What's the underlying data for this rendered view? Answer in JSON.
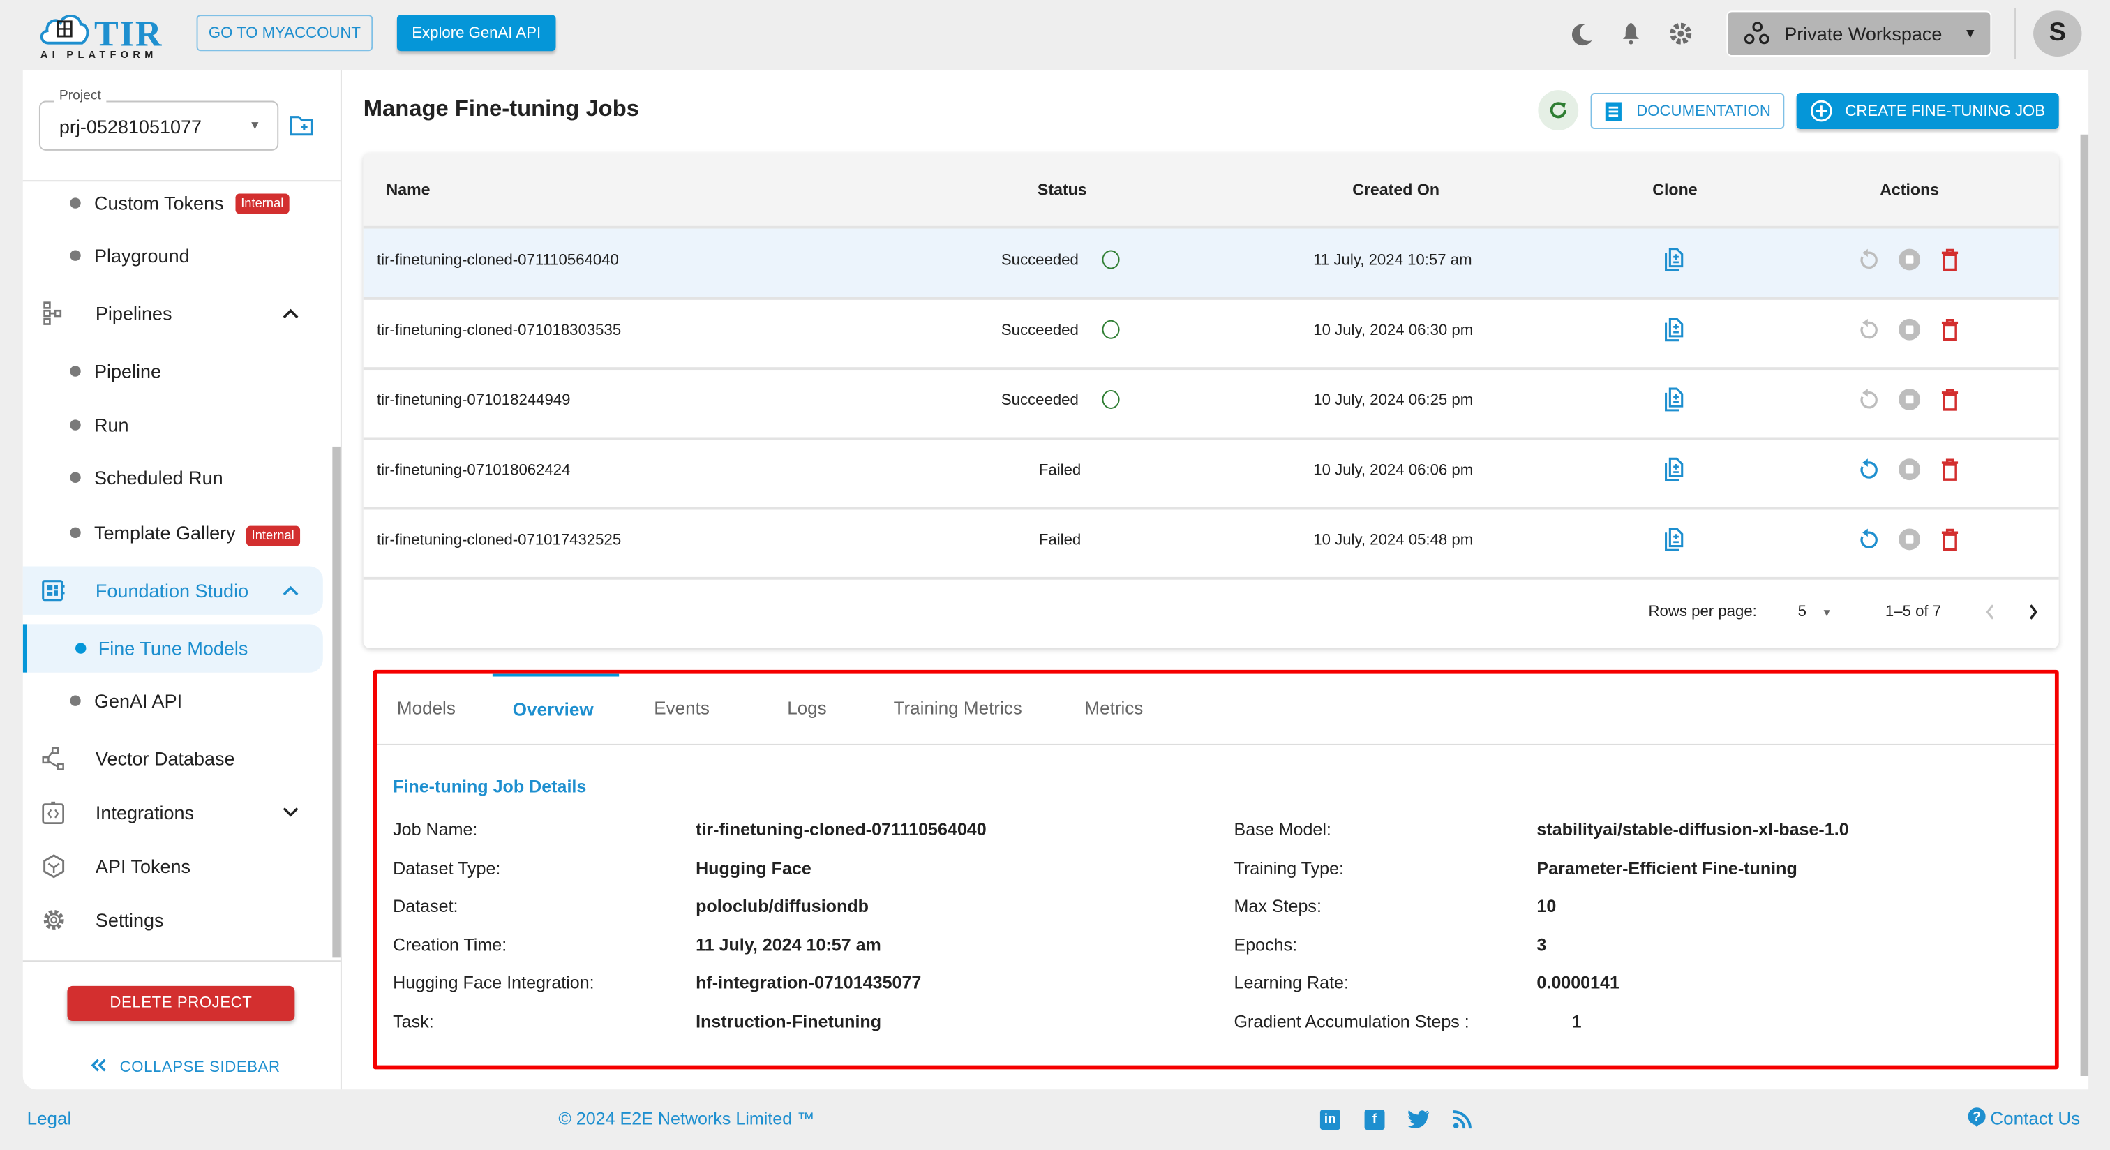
{
  "header": {
    "logo_title": "TIR",
    "logo_subtitle": "AI PLATFORM",
    "myaccount_button": "GO TO MYACCOUNT",
    "genai_button": "Explore GenAI API",
    "workspace_label": "Private Workspace",
    "avatar_initial": "S",
    "icons": [
      "moon-icon",
      "bell-icon",
      "gear-icon"
    ]
  },
  "sidebar": {
    "project_label": "Project",
    "project_value": "prj-05281051077",
    "items": [
      {
        "label": "Custom Tokens",
        "type": "sub",
        "badge": "Internal"
      },
      {
        "label": "Playground",
        "type": "sub"
      },
      {
        "label": "Pipelines",
        "type": "parent",
        "icon": "pipeline-icon",
        "expanded": true
      },
      {
        "label": "Pipeline",
        "type": "sub"
      },
      {
        "label": "Run",
        "type": "sub"
      },
      {
        "label": "Scheduled Run",
        "type": "sub"
      },
      {
        "label": "Template Gallery",
        "type": "sub",
        "badge": "Internal"
      },
      {
        "label": "Foundation Studio",
        "type": "parent",
        "icon": "foundation-studio-icon",
        "expanded": true,
        "active": true
      },
      {
        "label": "Fine Tune Models",
        "type": "sub",
        "active": true
      },
      {
        "label": "GenAI API",
        "type": "sub"
      },
      {
        "label": "Vector Database",
        "type": "parent",
        "icon": "vector-database-icon"
      },
      {
        "label": "Integrations",
        "type": "parent",
        "icon": "integrations-icon",
        "expanded": false
      },
      {
        "label": "API Tokens",
        "type": "parent",
        "icon": "api-tokens-icon"
      },
      {
        "label": "Settings",
        "type": "parent",
        "icon": "settings-icon"
      }
    ],
    "delete_button": "DELETE PROJECT",
    "collapse_label": "COLLAPSE SIDEBAR"
  },
  "main": {
    "title": "Manage Fine-tuning Jobs",
    "documentation_button": "DOCUMENTATION",
    "create_button": "CREATE FINE-TUNING JOB",
    "table": {
      "columns": [
        "Name",
        "Status",
        "Created On",
        "Clone",
        "Actions"
      ],
      "rows": [
        {
          "name": "tir-finetuning-cloned-071110564040",
          "status": "Succeeded",
          "created": "11 July, 2024 10:57 am",
          "retry_enabled": false,
          "selected": true
        },
        {
          "name": "tir-finetuning-cloned-071018303535",
          "status": "Succeeded",
          "created": "10 July, 2024 06:30 pm",
          "retry_enabled": false
        },
        {
          "name": "tir-finetuning-071018244949",
          "status": "Succeeded",
          "created": "10 July, 2024 06:25 pm",
          "retry_enabled": false
        },
        {
          "name": "tir-finetuning-071018062424",
          "status": "Failed",
          "created": "10 July, 2024 06:06 pm",
          "retry_enabled": true
        },
        {
          "name": "tir-finetuning-cloned-071017432525",
          "status": "Failed",
          "created": "10 July, 2024 05:48 pm",
          "retry_enabled": true
        }
      ],
      "pagination": {
        "rows_per_page_label": "Rows per page:",
        "rows_per_page": "5",
        "range": "1–5 of 7"
      }
    },
    "details": {
      "tabs": [
        "Models",
        "Overview",
        "Events",
        "Logs",
        "Training Metrics",
        "Metrics"
      ],
      "active_tab": "Overview",
      "section_title": "Fine-tuning Job Details",
      "left": [
        {
          "label": "Job Name:",
          "value": "tir-finetuning-cloned-071110564040"
        },
        {
          "label": "Dataset Type:",
          "value": "Hugging Face"
        },
        {
          "label": "Dataset:",
          "value": "poloclub/diffusiondb"
        },
        {
          "label": "Creation Time:",
          "value": "11 July, 2024 10:57 am"
        },
        {
          "label": "Hugging Face Integration:",
          "value": "hf-integration-07101435077"
        },
        {
          "label": "Task:",
          "value": "Instruction-Finetuning"
        }
      ],
      "right": [
        {
          "label": "Base Model:",
          "value": "stabilityai/stable-diffusion-xl-base-1.0"
        },
        {
          "label": "Training Type:",
          "value": "Parameter-Efficient Fine-tuning"
        },
        {
          "label": "Max Steps:",
          "value": "10"
        },
        {
          "label": "Epochs:",
          "value": "3"
        },
        {
          "label": "Learning Rate:",
          "value": "0.0000141"
        },
        {
          "label": "Gradient Accumulation Steps :",
          "value": "1"
        }
      ]
    }
  },
  "footer": {
    "legal": "Legal",
    "copyright": "© 2024 E2E Networks Limited ™",
    "contact": "Contact Us",
    "social": [
      "linkedin-icon",
      "facebook-icon",
      "twitter-icon",
      "rss-icon"
    ]
  },
  "colors": {
    "accent": "#0596d8",
    "danger": "#d32f2f",
    "success": "#2e7d32",
    "highlight_border": "#f50000"
  }
}
